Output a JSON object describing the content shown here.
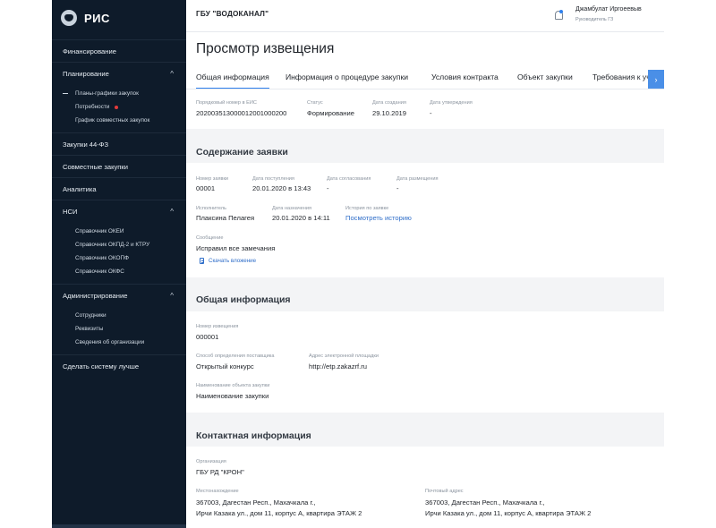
{
  "app": {
    "title": "РИС"
  },
  "header": {
    "org": "ГБУ \"ВОДОКАНАЛ\"",
    "user_name": "Джамбулат Иргоеевыв",
    "user_role": "Руководитель ГЗ"
  },
  "sidebar": {
    "items": [
      {
        "label": "Финансирование"
      },
      {
        "label": "Планирование",
        "chevron": "^"
      },
      {
        "label": "Закупки 44-ФЗ"
      },
      {
        "label": "Совместные закупки"
      },
      {
        "label": "Аналитика"
      },
      {
        "label": "НСИ",
        "chevron": "^"
      },
      {
        "label": "Администрирование",
        "chevron": "^"
      },
      {
        "label": "Сделать систему лучше"
      }
    ],
    "planning_sub": [
      {
        "label": "Планы-графики закупок"
      },
      {
        "label": "Потребности"
      },
      {
        "label": "График совместных закупок"
      }
    ],
    "nsi_sub": [
      {
        "label": "Справочник ОКЕИ"
      },
      {
        "label": "Справочник ОКПД-2 и КТРУ"
      },
      {
        "label": "Справочник ОКОПФ"
      },
      {
        "label": "Справочник ОКФС"
      }
    ],
    "admin_sub": [
      {
        "label": "Сотрудники"
      },
      {
        "label": "Реквизиты"
      },
      {
        "label": "Сведения об организации"
      }
    ]
  },
  "page": {
    "title": "Просмотр извещения",
    "tabs": [
      {
        "label": "Общая информация"
      },
      {
        "label": "Информация о процедуре закупки"
      },
      {
        "label": "Условия контракта"
      },
      {
        "label": "Объект закупки"
      },
      {
        "label": "Требования к участ"
      }
    ],
    "tab_scroll": "›",
    "summary": {
      "eis_label": "Порядковый номер в ЕИС",
      "eis_value": "20200351300001200100020​0",
      "status_label": "Статус",
      "status_value": "Формирование",
      "created_label": "Дата создания",
      "created_value": "29.10.2019",
      "approved_label": "Дата утверждения",
      "approved_value": "-"
    },
    "application": {
      "title": "Содержание заявки",
      "number_label": "Номер заявки",
      "number_value": "00001",
      "received_label": "Дата поступления",
      "received_value": "20.01.2020 в 13:43",
      "agreed_label": "Дата согласования",
      "agreed_value": "-",
      "placed_label": "Дата размещения",
      "placed_value": "-",
      "executor_label": "Исполнитель",
      "executor_value": "Плаксина Пелагея",
      "assigned_label": "Дата назначения",
      "assigned_value": "20.01.2020 в 14:11",
      "history_label": "История по заявке",
      "history_link": "Посмотреть историю",
      "message_label": "Сообщение",
      "message_value": "Исправил все замечания",
      "attachment": "Скачать вложение"
    },
    "general": {
      "title": "Общая информация",
      "notice_label": "Номер извещения",
      "notice_value": "000001",
      "method_label": "Способ определения поставщика",
      "method_value": "Открытый конкурс",
      "platform_label": "Адрес электронной площадки",
      "platform_value": "http://etp.zakazrf.ru",
      "object_label": "Наименование объекта закупки",
      "object_value": "Наименование закупки"
    },
    "contacts": {
      "title": "Контактная информация",
      "org_label": "Организация",
      "org_value": "ГБУ РД \"КРОН\"",
      "location_label": "Местонахождение",
      "location_line1": "367003, Дагестан Респ., Махачкала г.,",
      "location_line2": "Ирчи Казака ул., дом 11, корпус А, квартира ЭТАЖ 2",
      "postal_label": "Почтовый адрес",
      "postal_line1": "367003, Дагестан Респ., Махачкала г.,",
      "postal_line2": "Ирчи Казака ул., дом 11, корпус А, квартира ЭТАЖ 2"
    }
  }
}
